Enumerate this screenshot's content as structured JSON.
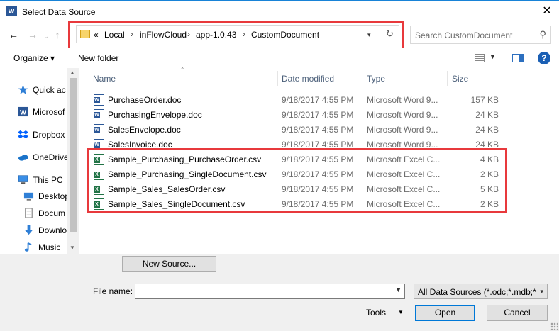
{
  "window": {
    "title": "Select Data Source",
    "app_icon": "W",
    "close_glyph": "✕"
  },
  "nav": {
    "back_glyph": "←",
    "forward_glyph": "→",
    "up_glyph": "↑",
    "recent_glyph": "⌄"
  },
  "address": {
    "overflow": "«",
    "crumbs": [
      "Local",
      "inFlowCloud",
      "app-1.0.43",
      "CustomDocument"
    ],
    "refresh_glyph": "↻"
  },
  "search": {
    "placeholder": "Search CustomDocument",
    "icon_glyph": "⚲"
  },
  "toolbar": {
    "organize_label": "Organize",
    "organize_chev": "▾",
    "new_folder_label": "New folder",
    "help_glyph": "?"
  },
  "sidebar": {
    "items": [
      {
        "label": "Quick ac",
        "icon": "star-icon"
      },
      {
        "label": "Microsof",
        "icon": "word-icon"
      },
      {
        "label": "Dropbox",
        "icon": "dropbox-icon"
      },
      {
        "label": "OneDrive",
        "icon": "cloud-icon"
      },
      {
        "label": "This PC",
        "icon": "computer-icon"
      },
      {
        "label": "Desktop",
        "icon": "desktop-icon"
      },
      {
        "label": "Docum",
        "icon": "document-icon"
      },
      {
        "label": "Downlo",
        "icon": "download-icon"
      },
      {
        "label": "Music",
        "icon": "music-icon"
      }
    ]
  },
  "columns": {
    "name": "Name",
    "date": "Date modified",
    "type": "Type",
    "size": "Size",
    "sort_glyph": "^"
  },
  "files": [
    {
      "name": "PurchaseOrder.doc",
      "date": "9/18/2017 4:55 PM",
      "type": "Microsoft Word 9...",
      "size": "157 KB",
      "icon": "word-doc-icon"
    },
    {
      "name": "PurchasingEnvelope.doc",
      "date": "9/18/2017 4:55 PM",
      "type": "Microsoft Word 9...",
      "size": "24 KB",
      "icon": "word-doc-icon"
    },
    {
      "name": "SalesEnvelope.doc",
      "date": "9/18/2017 4:55 PM",
      "type": "Microsoft Word 9...",
      "size": "24 KB",
      "icon": "word-doc-icon"
    },
    {
      "name": "SalesInvoice.doc",
      "date": "9/18/2017 4:55 PM",
      "type": "Microsoft Word 9...",
      "size": "24 KB",
      "icon": "word-doc-icon"
    },
    {
      "name": "Sample_Purchasing_PurchaseOrder.csv",
      "date": "9/18/2017 4:55 PM",
      "type": "Microsoft Excel C...",
      "size": "4 KB",
      "icon": "excel-csv-icon"
    },
    {
      "name": "Sample_Purchasing_SingleDocument.csv",
      "date": "9/18/2017 4:55 PM",
      "type": "Microsoft Excel C...",
      "size": "2 KB",
      "icon": "excel-csv-icon"
    },
    {
      "name": "Sample_Sales_SalesOrder.csv",
      "date": "9/18/2017 4:55 PM",
      "type": "Microsoft Excel C...",
      "size": "5 KB",
      "icon": "excel-csv-icon"
    },
    {
      "name": "Sample_Sales_SingleDocument.csv",
      "date": "9/18/2017 4:55 PM",
      "type": "Microsoft Excel C...",
      "size": "2 KB",
      "icon": "excel-csv-icon"
    }
  ],
  "bottom": {
    "new_source_label": "New Source...",
    "file_name_label": "File name:",
    "file_name_value": "",
    "filter_value": "All Data Sources (*.odc;*.mdb;*",
    "tools_label": "Tools",
    "open_label": "Open",
    "cancel_label": "Cancel",
    "drop_glyph": "▾"
  },
  "colors": {
    "highlight": "#e8393c",
    "accent": "#0078d7"
  }
}
